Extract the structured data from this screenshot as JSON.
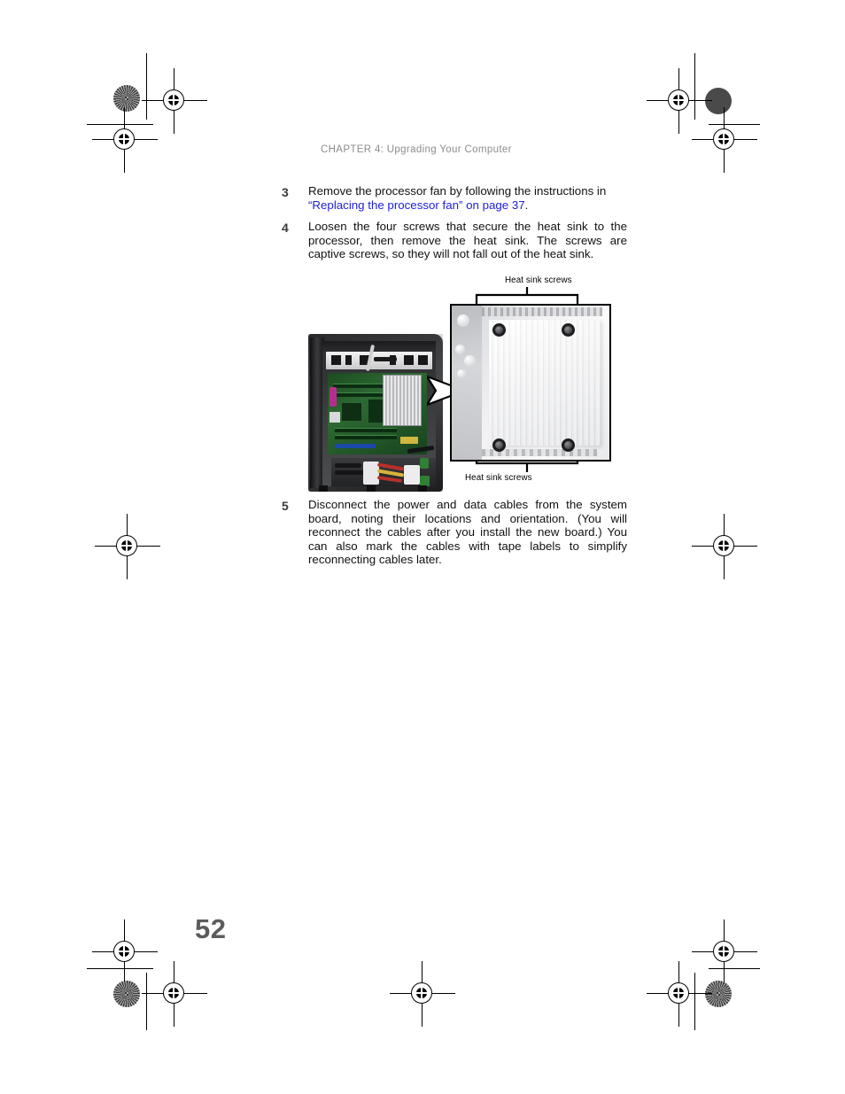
{
  "document": {
    "running_header": "CHAPTER 4: Upgrading Your Computer",
    "page_number": "52"
  },
  "steps": [
    {
      "number": "3",
      "text_before_link": "Remove the processor fan by following the instructions in ",
      "link_text": "“Replacing the processor fan” on page 37",
      "text_after_link": "."
    },
    {
      "number": "4",
      "text_before_link": "Loosen the four screws that secure the heat sink to the processor, then remove the heat sink. The screws are captive screws, so they will not fall out of the heat sink.",
      "link_text": "",
      "text_after_link": ""
    },
    {
      "number": "5",
      "text_before_link": "Disconnect the power and data cables from the system board, noting their locations and orientation. (You will reconnect the cables after you install the new board.) You can also mark the cables with tape labels to simplify reconnecting cables later.",
      "link_text": "",
      "text_after_link": ""
    }
  ],
  "figure": {
    "caption_top": "Heat sink screws",
    "caption_bottom": "Heat sink screws",
    "photo_left_name": "computer-chassis-interior-photo",
    "photo_right_name": "heat-sink-closeup-photo",
    "screw_count": 4
  },
  "colors": {
    "link": "#2020dd",
    "header_gray": "#8d8d8d",
    "step_number": "#3a3a3a",
    "body_text": "#111111",
    "page_number": "#5c5c5c"
  }
}
